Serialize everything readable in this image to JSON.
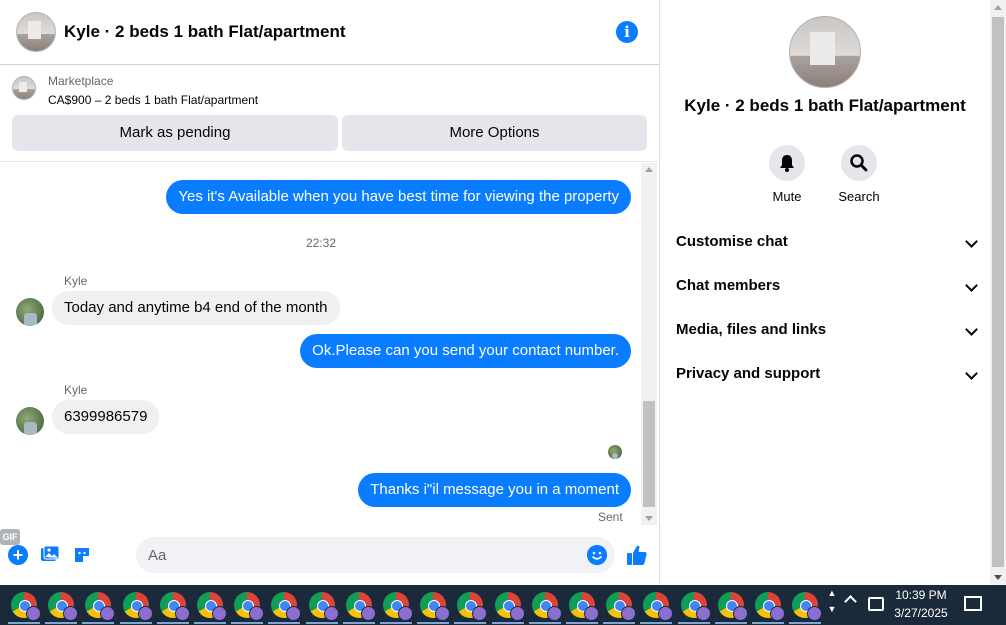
{
  "header": {
    "title": "Kyle · 2 beds 1 bath Flat/apartment"
  },
  "marketplace": {
    "label": "Marketplace",
    "listing": "CA$900 – 2 beds 1 bath Flat/apartment",
    "mark_pending": "Mark as pending",
    "more_options": "More Options"
  },
  "messages": {
    "m1": "Yes it's Available when you have best time for viewing the property",
    "timestamp": "22:32",
    "sender1": "Kyle",
    "m2": "Today and anytime b4 end of the month",
    "m3": "Ok.Please can you send your contact number.",
    "sender2": "Kyle",
    "m4": "6399986579",
    "m5": "Thanks i\"il message you in a moment",
    "status": "Sent"
  },
  "composer": {
    "placeholder": "Aa",
    "gif": "GIF"
  },
  "details": {
    "title": "Kyle · 2 beds 1 bath Flat/apartment",
    "mute": "Mute",
    "search": "Search",
    "sections": [
      "Customise chat",
      "Chat members",
      "Media, files and links",
      "Privacy and support"
    ]
  },
  "taskbar": {
    "time": "10:39 PM",
    "date": "3/27/2025",
    "app_count": 22
  },
  "colors": {
    "accent": "#0a7cff",
    "incoming_bubble": "#f0f0f0",
    "taskbar": "#1b2a3a"
  }
}
